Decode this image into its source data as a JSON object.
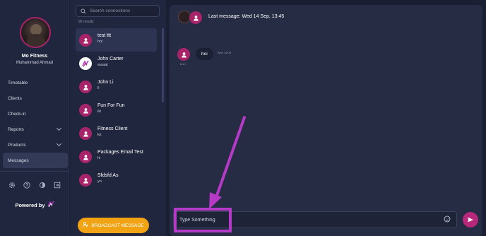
{
  "sidebar": {
    "gym_name": "Mo Fitness",
    "user_name": "Muhammad Ahmad",
    "nav": [
      {
        "label": "Timetable",
        "has_chevron": false,
        "active": false
      },
      {
        "label": "Clients",
        "has_chevron": false,
        "active": false
      },
      {
        "label": "Check-in",
        "has_chevron": false,
        "active": false
      },
      {
        "label": "Reports",
        "has_chevron": true,
        "active": false
      },
      {
        "label": "Products",
        "has_chevron": true,
        "active": false
      },
      {
        "label": "Messages",
        "has_chevron": false,
        "active": true
      }
    ],
    "tools": [
      "gear-icon",
      "help-icon",
      "theme-icon",
      "logout-icon"
    ],
    "powered_by": "Powered by"
  },
  "connections": {
    "search_placeholder": "Search connections",
    "results_count": "95 results",
    "items": [
      {
        "name": "test ttt",
        "message": "hoi",
        "avatar": "user",
        "active": true
      },
      {
        "name": "John Carter",
        "message": "waaat",
        "avatar": "logo",
        "active": false
      },
      {
        "name": "John Li",
        "message": "ll",
        "avatar": "user",
        "active": false
      },
      {
        "name": "Fun For Fun",
        "message": "iki",
        "avatar": "user",
        "active": false
      },
      {
        "name": "Fitness Client",
        "message": "kk",
        "avatar": "user",
        "active": false
      },
      {
        "name": "Packages Email Test",
        "message": "hi",
        "avatar": "user",
        "active": false
      },
      {
        "name": "Sfdsfd As",
        "message": "yo",
        "avatar": "user",
        "active": false
      }
    ],
    "broadcast_label": "BROADCAST MESSAGE"
  },
  "chat": {
    "last_message": "Last message: Wed 14 Sep, 13:45",
    "messages": [
      {
        "sender": "test t",
        "text": "hoi",
        "time": "Wed 14/09"
      }
    ],
    "input_placeholder": "Type Something"
  },
  "colors": {
    "accent": "#a8246a",
    "broadcast": "#f1a314",
    "annotation": "#b53ac5"
  }
}
